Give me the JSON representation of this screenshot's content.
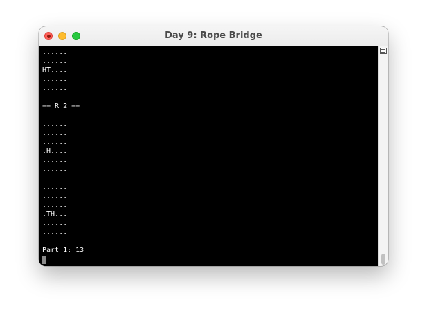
{
  "window": {
    "title": "Day 9: Rope Bridge"
  },
  "terminal": {
    "lines": [
      "......",
      "......",
      "HT....",
      "......",
      "......",
      "",
      "== R 2 ==",
      "",
      "......",
      "......",
      "......",
      ".H....",
      "......",
      "......",
      "",
      "......",
      "......",
      "......",
      ".TH...",
      "......",
      "......",
      "",
      "Part 1: 13"
    ]
  },
  "colors": {
    "terminal_background": "#000000",
    "terminal_text": "#ffffff",
    "close": "#fe5f57",
    "minimize": "#febc2e",
    "maximize": "#28c840"
  },
  "icons": {
    "close": "close-icon",
    "minimize": "minimize-icon",
    "maximize": "maximize-icon",
    "scroll_menu": "scrollbar-menu-icon"
  }
}
